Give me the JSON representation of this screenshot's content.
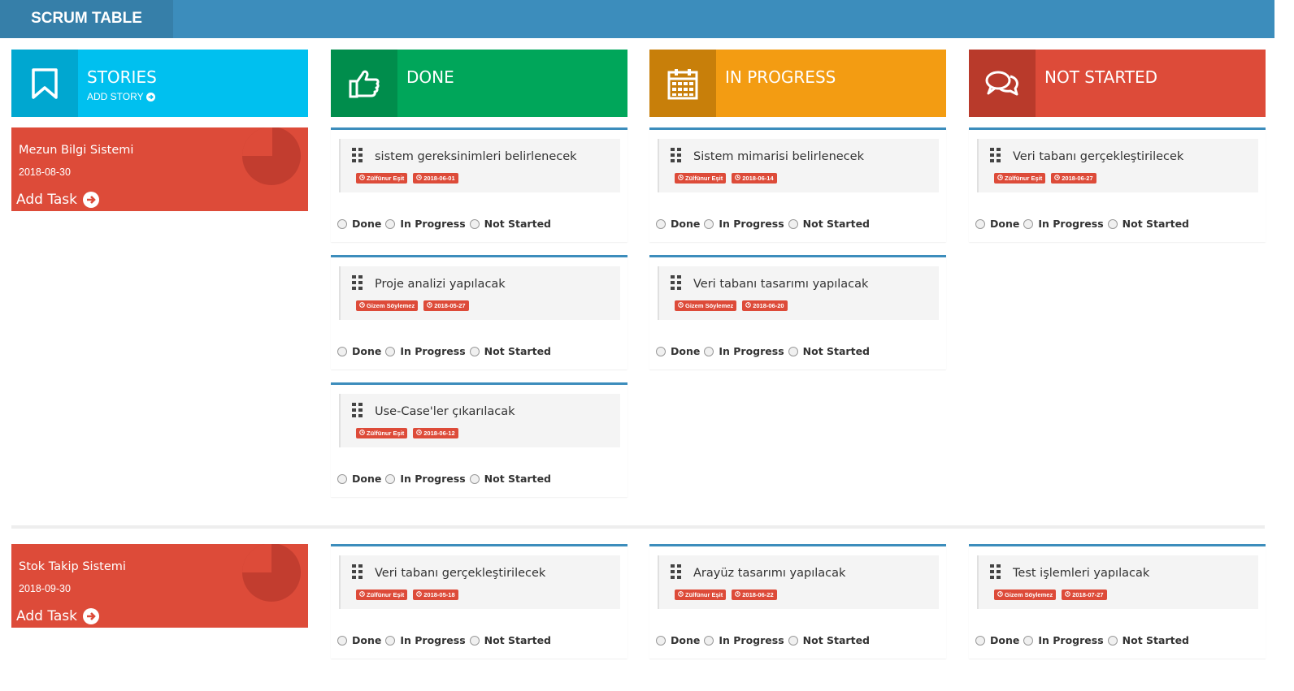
{
  "app": {
    "title": "SCRUM TABLE"
  },
  "colors": {
    "stories": "#00c0ef",
    "done": "#00a65a",
    "in_progress": "#f39c12",
    "not_started": "#dd4b39",
    "topbar": "#3c8dbc"
  },
  "columns": {
    "stories": {
      "title": "STORIES",
      "action": "ADD STORY",
      "icon": "bookmark-icon"
    },
    "done": {
      "title": "DONE",
      "icon": "thumbs-up-icon"
    },
    "in_progress": {
      "title": "IN PROGRESS",
      "icon": "calendar-icon"
    },
    "not_started": {
      "title": "NOT STARTED",
      "icon": "comments-icon"
    }
  },
  "radio_labels": {
    "done": "Done",
    "in_progress": "In Progress",
    "not_started": "Not Started"
  },
  "stories": [
    {
      "name": "Mezun Bilgi Sistemi",
      "date": "2018-08-30",
      "add_task": "Add Task",
      "done": [
        {
          "title": "sistem gereksinimleri belirlenecek",
          "assignee": "Zülfünur Eşit",
          "date": "2018-06-01"
        },
        {
          "title": "Proje analizi yapılacak",
          "assignee": "Gizem Söylemez",
          "date": "2018-05-27"
        },
        {
          "title": "Use-Case'ler çıkarılacak",
          "assignee": "Zülfünur Eşit",
          "date": "2018-06-12"
        }
      ],
      "in_progress": [
        {
          "title": "Sistem mimarisi belirlenecek",
          "assignee": "Zülfünur Eşit",
          "date": "2018-06-14"
        },
        {
          "title": "Veri tabanı tasarımı yapılacak",
          "assignee": "Gizem Söylemez",
          "date": "2018-06-20"
        }
      ],
      "not_started": [
        {
          "title": "Veri tabanı gerçekleştirilecek",
          "assignee": "Zülfünur Eşit",
          "date": "2018-06-27"
        }
      ]
    },
    {
      "name": "Stok Takip Sistemi",
      "date": "2018-09-30",
      "add_task": "Add Task",
      "done": [
        {
          "title": "Veri tabanı gerçekleştirilecek",
          "assignee": "Zülfünur Eşit",
          "date": "2018-05-18"
        }
      ],
      "in_progress": [
        {
          "title": "Arayüz tasarımı yapılacak",
          "assignee": "Zülfünur Eşit",
          "date": "2018-06-22"
        }
      ],
      "not_started": [
        {
          "title": "Test işlemleri yapılacak",
          "assignee": "Gizem Söylemez",
          "date": "2018-07-27"
        }
      ]
    }
  ]
}
